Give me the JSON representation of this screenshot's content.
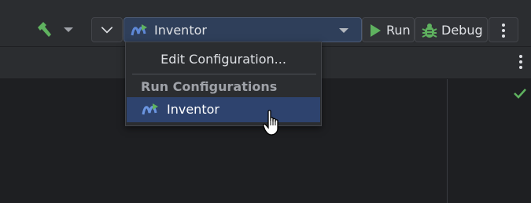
{
  "toolbar": {
    "run_configuration": {
      "selected": "Inventor"
    },
    "run_label": "Run",
    "debug_label": "Debug"
  },
  "popup": {
    "edit_item": "Edit Configuration...",
    "section_title": "Run Configurations",
    "items": [
      {
        "label": "Inventor",
        "selected": true
      }
    ]
  },
  "colors": {
    "background": "#1e1f22",
    "toolbar": "#2b2d30",
    "accent_green": "#5fb25f",
    "selection": "#2e436e",
    "config_icon_blue": "#5e88d6"
  },
  "icons": {
    "build": "hammer-icon",
    "config": "android-run-config-icon",
    "run": "play-icon",
    "debug": "bug-icon",
    "more": "kebab-menu-icon",
    "status": "checkmark-icon"
  }
}
